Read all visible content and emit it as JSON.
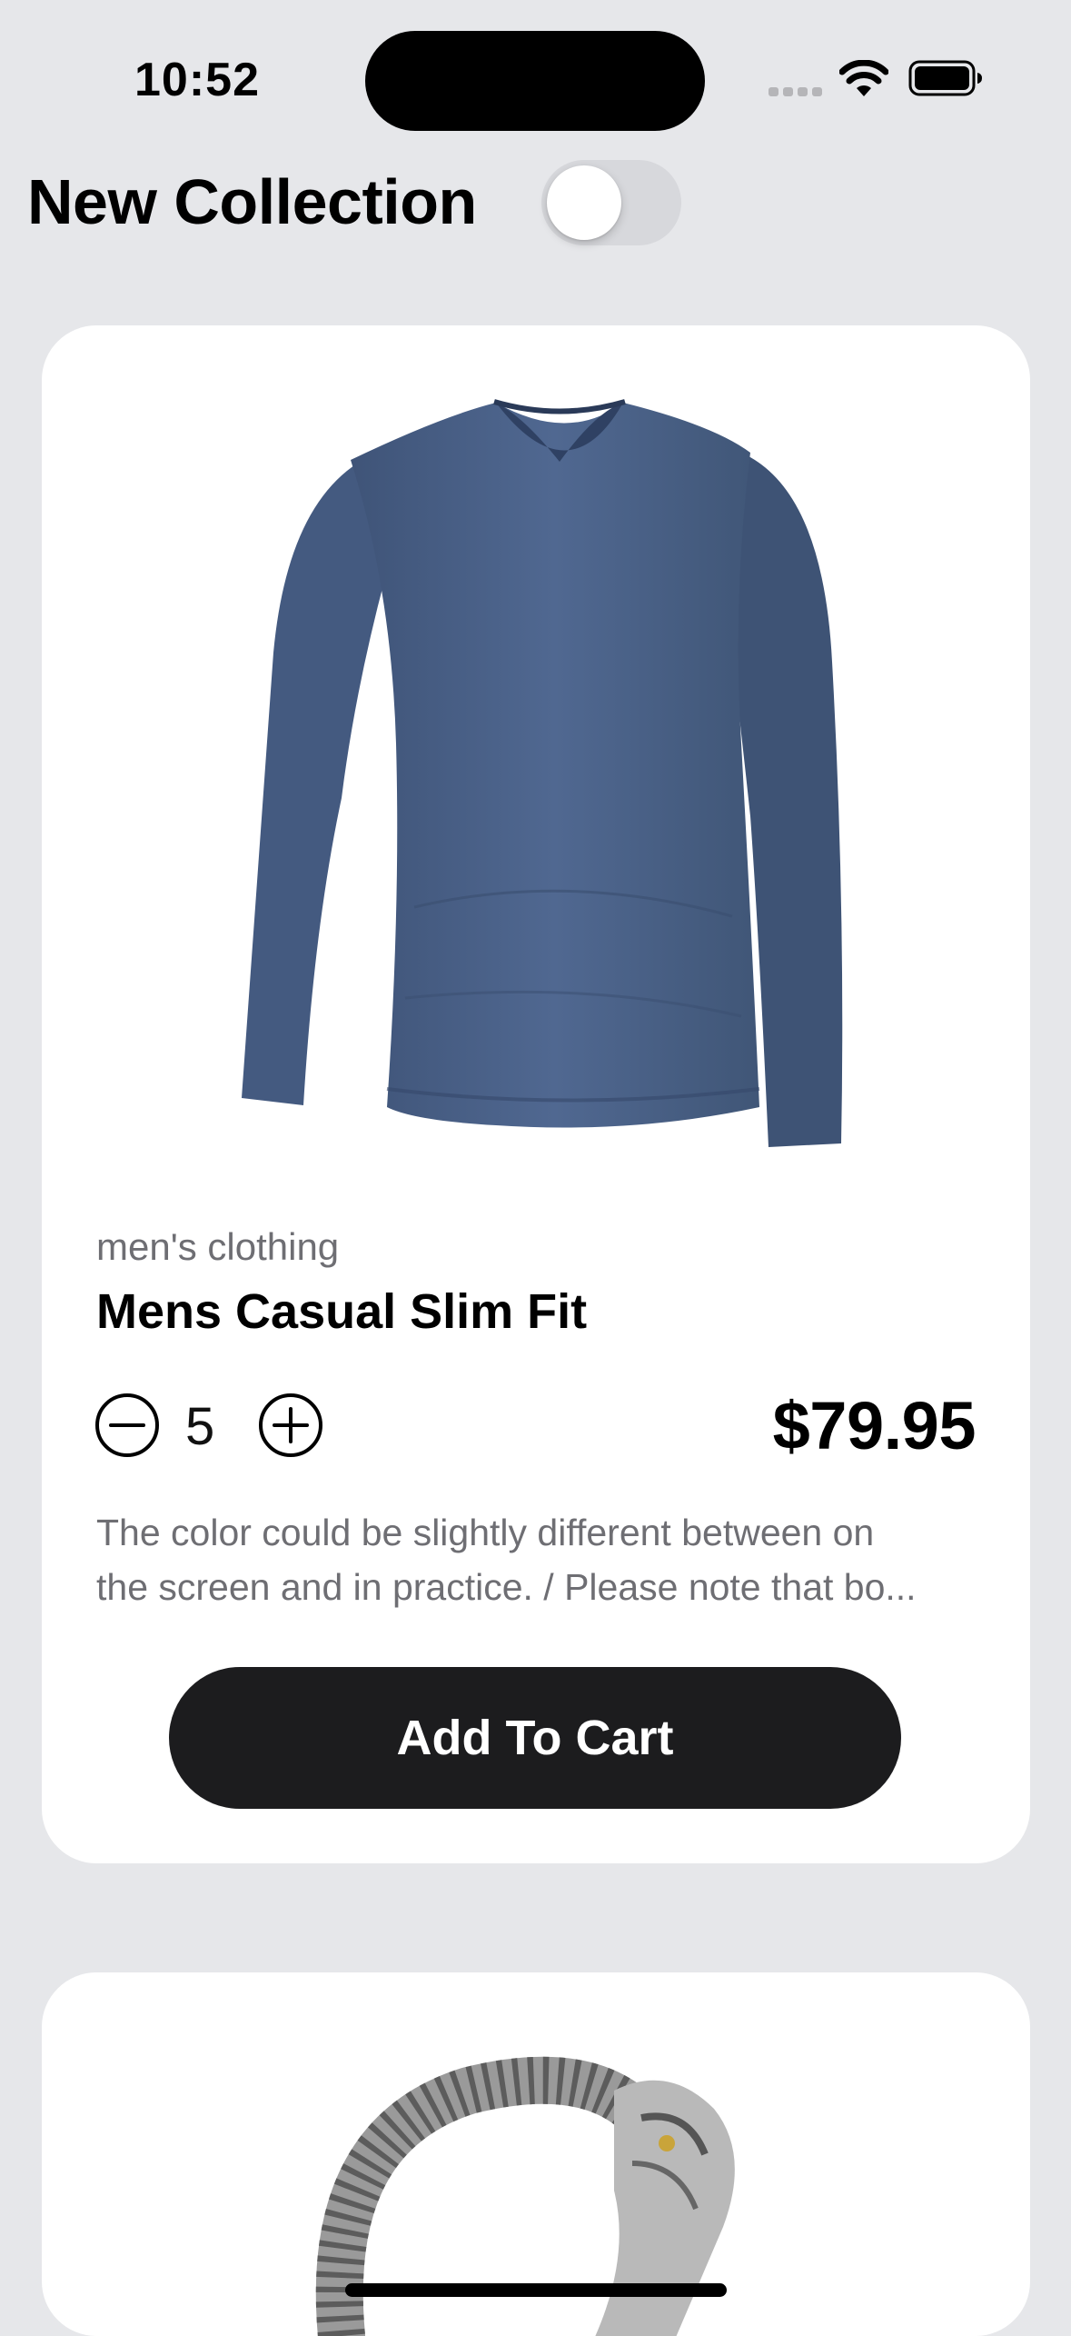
{
  "status_bar": {
    "time": "10:52",
    "icons": [
      "signal-icon",
      "wifi-icon",
      "battery-icon"
    ]
  },
  "header": {
    "title": "New Collection",
    "toggle_on": false
  },
  "products": [
    {
      "category": "men's clothing",
      "title": "Mens Casual Slim Fit",
      "quantity": "5",
      "price": "$79.95",
      "description_line1": "The color could be slightly different between on",
      "description_line2": "the screen and in practice. / Please note that bo...",
      "button_label": "Add To Cart",
      "image": "long-sleeve-v-neck-shirt-image",
      "shirt_color": "#4a6189"
    },
    {
      "image": "dragon-chain-bracelet-image"
    }
  ],
  "colors": {
    "background": "#e6e7ea",
    "card": "#ffffff",
    "button": "#1c1c1e",
    "secondary_text": "#6e6e73"
  }
}
